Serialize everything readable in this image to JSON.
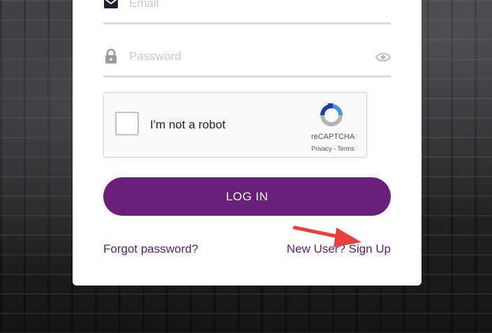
{
  "form": {
    "email_placeholder": "Email",
    "password_placeholder": "Password"
  },
  "recaptcha": {
    "label": "I'm not a robot",
    "brand": "reCAPTCHA",
    "links": "Privacy - Terms"
  },
  "buttons": {
    "login": "LOG IN"
  },
  "links": {
    "forgot": "Forgot password?",
    "signup": "New User? Sign Up"
  },
  "icons": {
    "email": "envelope-icon",
    "password": "lock-icon",
    "show_password": "eye-icon",
    "recaptcha": "recaptcha-logo-icon",
    "annotation": "red-arrow-icon"
  },
  "colors": {
    "brand_purple": "#6a1f7a",
    "link_purple": "#5b1d6b",
    "annotation_red": "#e8403c"
  }
}
